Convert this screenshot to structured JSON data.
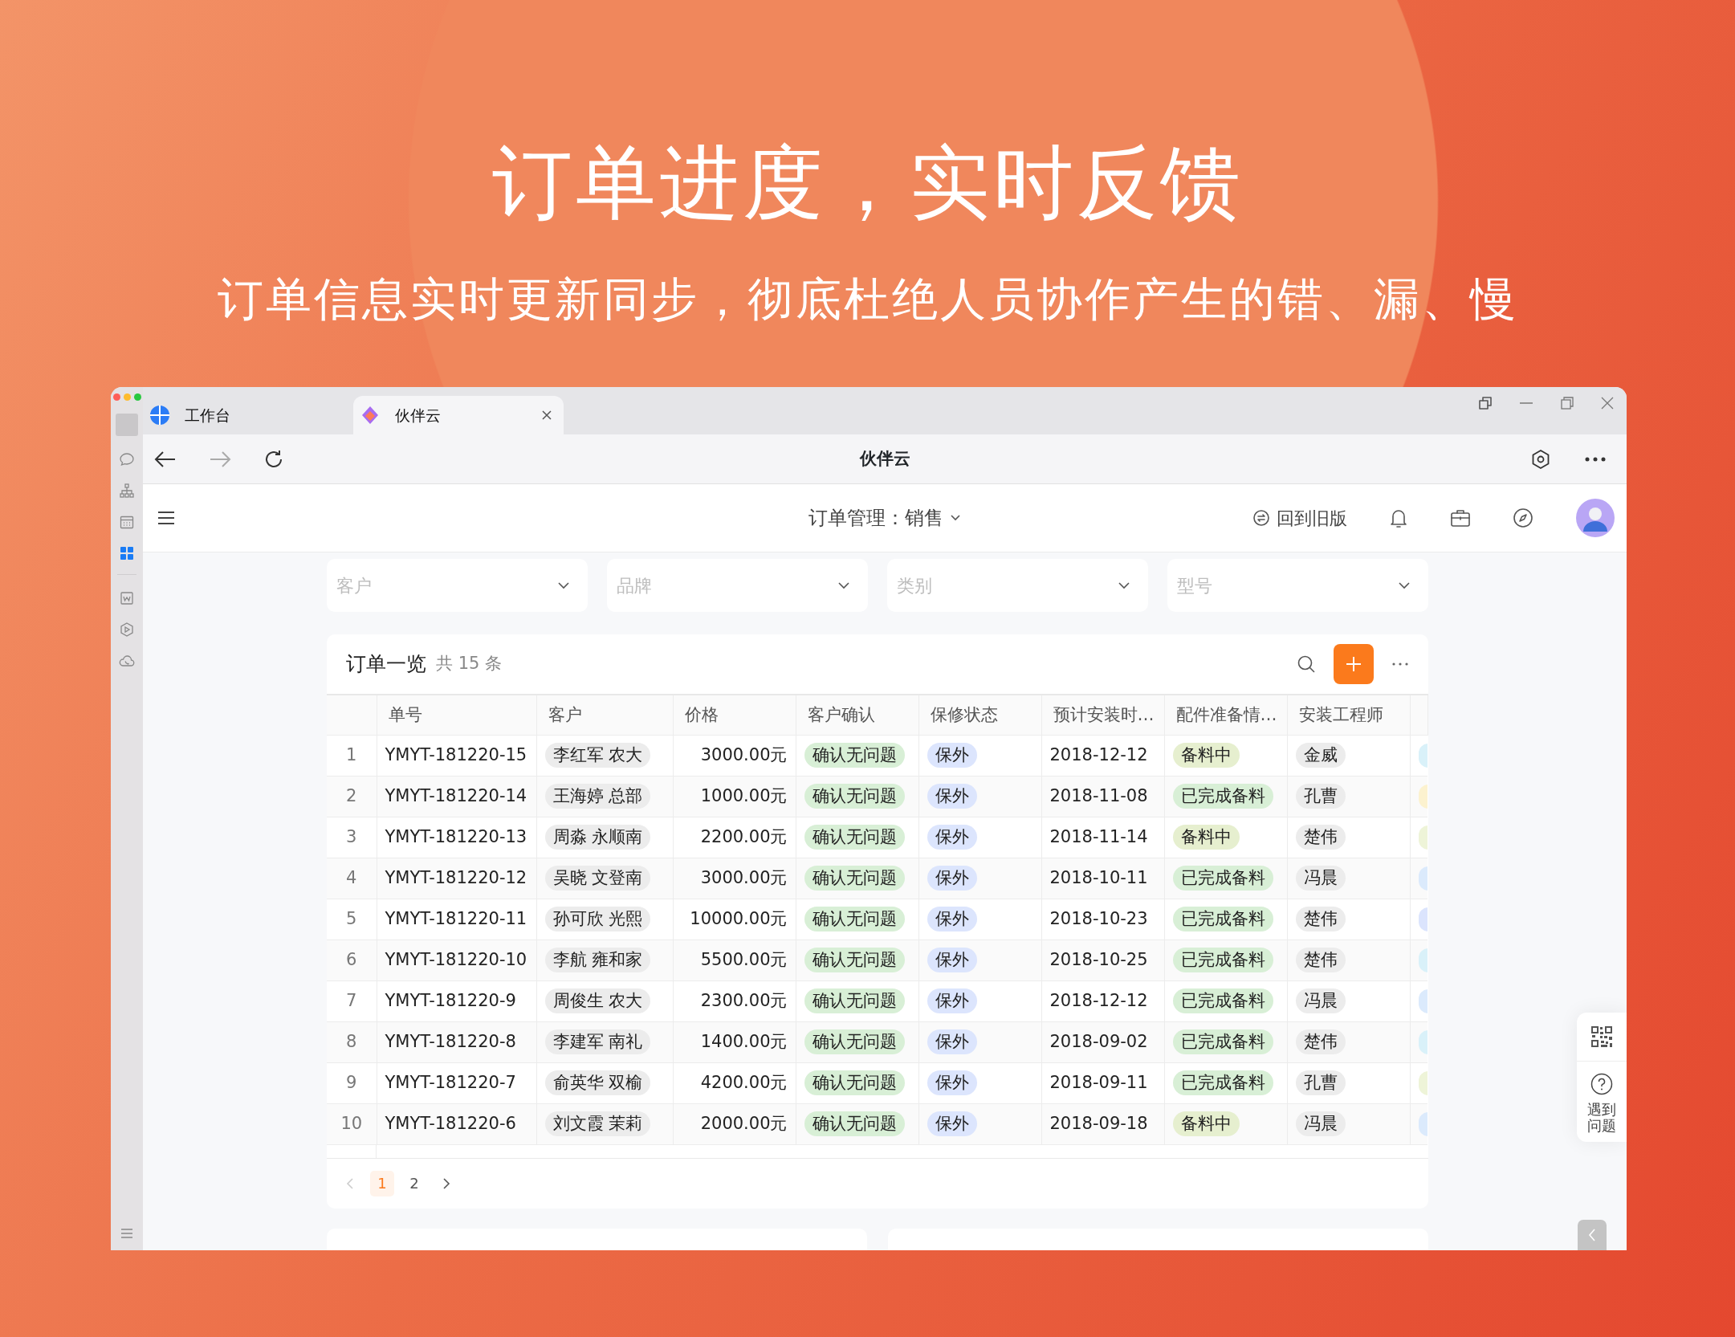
{
  "headline": "订单进度，实时反馈",
  "subheadline": "订单信息实时更新同步，彻底杜绝人员协作产生的错、漏、慢",
  "window": {
    "tabs": [
      {
        "label": "工作台",
        "selected": false
      },
      {
        "label": "伙伴云",
        "selected": true
      }
    ],
    "title": "伙伴云"
  },
  "sidebar": {
    "items": [
      {
        "kind": "chat",
        "selected": false
      },
      {
        "kind": "org",
        "selected": false
      },
      {
        "kind": "calendar",
        "selected": false
      },
      {
        "kind": "apps",
        "selected": true
      },
      {
        "kind": "doc",
        "selected": false
      },
      {
        "kind": "cube",
        "selected": false
      },
      {
        "kind": "cloud",
        "selected": false
      }
    ]
  },
  "header": {
    "title": "订单管理：销售",
    "legacy_link": "回到旧版"
  },
  "filters": [
    {
      "placeholder": "客户"
    },
    {
      "placeholder": "品牌"
    },
    {
      "placeholder": "类别"
    },
    {
      "placeholder": "型号"
    }
  ],
  "table": {
    "title": "订单一览",
    "count": "共 15 条",
    "columns": [
      "单号",
      "客户",
      "价格",
      "客户确认",
      "保修状态",
      "预计安装时…",
      "配件准备情…",
      "安装工程师"
    ],
    "rows": [
      {
        "index": "1",
        "order_no": "YMYT-181220-15",
        "customer": "李红军 农大",
        "price": "3000.00元",
        "confirmation": "确认无问题",
        "warranty": "保外",
        "install_date": "2018-12-12",
        "parts": {
          "text": "备料中",
          "color": "#e6efcf"
        },
        "engineer": "金威",
        "column_10": {
          "color": "#d9f1f9"
        }
      },
      {
        "index": "2",
        "order_no": "YMYT-181220-14",
        "customer": "王海婷 总部",
        "price": "1000.00元",
        "confirmation": "确认无问题",
        "warranty": "保外",
        "install_date": "2018-11-08",
        "parts": {
          "text": "已完成备料",
          "color": "#d8efd6"
        },
        "engineer": "孔曹",
        "column_10": {
          "color": "#fcf2cf"
        }
      },
      {
        "index": "3",
        "order_no": "YMYT-181220-13",
        "customer": "周淼 永顺南",
        "price": "2200.00元",
        "confirmation": "确认无问题",
        "warranty": "保外",
        "install_date": "2018-11-14",
        "parts": {
          "text": "备料中",
          "color": "#e6efcf"
        },
        "engineer": "楚伟",
        "column_10": {
          "color": "#eef4d8"
        }
      },
      {
        "index": "4",
        "order_no": "YMYT-181220-12",
        "customer": "吴晓 文登南",
        "price": "3000.00元",
        "confirmation": "确认无问题",
        "warranty": "保外",
        "install_date": "2018-10-11",
        "parts": {
          "text": "已完成备料",
          "color": "#d8efd6"
        },
        "engineer": "冯晨",
        "column_10": {
          "color": "#dbeafc"
        }
      },
      {
        "index": "5",
        "order_no": "YMYT-181220-11",
        "customer": "孙可欣 光熙",
        "price": "10000.00元",
        "confirmation": "确认无问题",
        "warranty": "保外",
        "install_date": "2018-10-23",
        "parts": {
          "text": "已完成备料",
          "color": "#d8efd6"
        },
        "engineer": "楚伟",
        "column_10": {
          "color": "#dbe4fd"
        }
      },
      {
        "index": "6",
        "order_no": "YMYT-181220-10",
        "customer": "李航 雍和家",
        "price": "5500.00元",
        "confirmation": "确认无问题",
        "warranty": "保外",
        "install_date": "2018-10-25",
        "parts": {
          "text": "已完成备料",
          "color": "#d8efd6"
        },
        "engineer": "楚伟",
        "column_10": {
          "color": "#d9f1f9"
        }
      },
      {
        "index": "7",
        "order_no": "YMYT-181220-9",
        "customer": "周俊生 农大",
        "price": "2300.00元",
        "confirmation": "确认无问题",
        "warranty": "保外",
        "install_date": "2018-12-12",
        "parts": {
          "text": "已完成备料",
          "color": "#d8efd6"
        },
        "engineer": "冯晨",
        "column_10": {
          "color": "#dbeafc"
        }
      },
      {
        "index": "8",
        "order_no": "YMYT-181220-8",
        "customer": "李建军 南礼",
        "price": "1400.00元",
        "confirmation": "确认无问题",
        "warranty": "保外",
        "install_date": "2018-09-02",
        "parts": {
          "text": "已完成备料",
          "color": "#d8efd6"
        },
        "engineer": "楚伟",
        "column_10": {
          "color": "#d9f1f9"
        }
      },
      {
        "index": "9",
        "order_no": "YMYT-181220-7",
        "customer": "俞英华 双榆",
        "price": "4200.00元",
        "confirmation": "确认无问题",
        "warranty": "保外",
        "install_date": "2018-09-11",
        "parts": {
          "text": "已完成备料",
          "color": "#d8efd6"
        },
        "engineer": "孔曹",
        "column_10": {
          "color": "#eef4d8"
        }
      },
      {
        "index": "10",
        "order_no": "YMYT-181220-6",
        "customer": "刘文霞 茉莉",
        "price": "2000.00元",
        "confirmation": "确认无问题",
        "warranty": "保外",
        "install_date": "2018-09-18",
        "parts": {
          "text": "备料中",
          "color": "#e6efcf"
        },
        "engineer": "冯晨",
        "column_10": {
          "color": "#dbeafc"
        }
      }
    ]
  },
  "pagination": {
    "prev_disabled": true,
    "next_disabled": false,
    "pages": [
      {
        "label": "1",
        "selected": true
      },
      {
        "label": "2",
        "selected": false
      }
    ]
  },
  "help": {
    "label": "遇到问题"
  }
}
